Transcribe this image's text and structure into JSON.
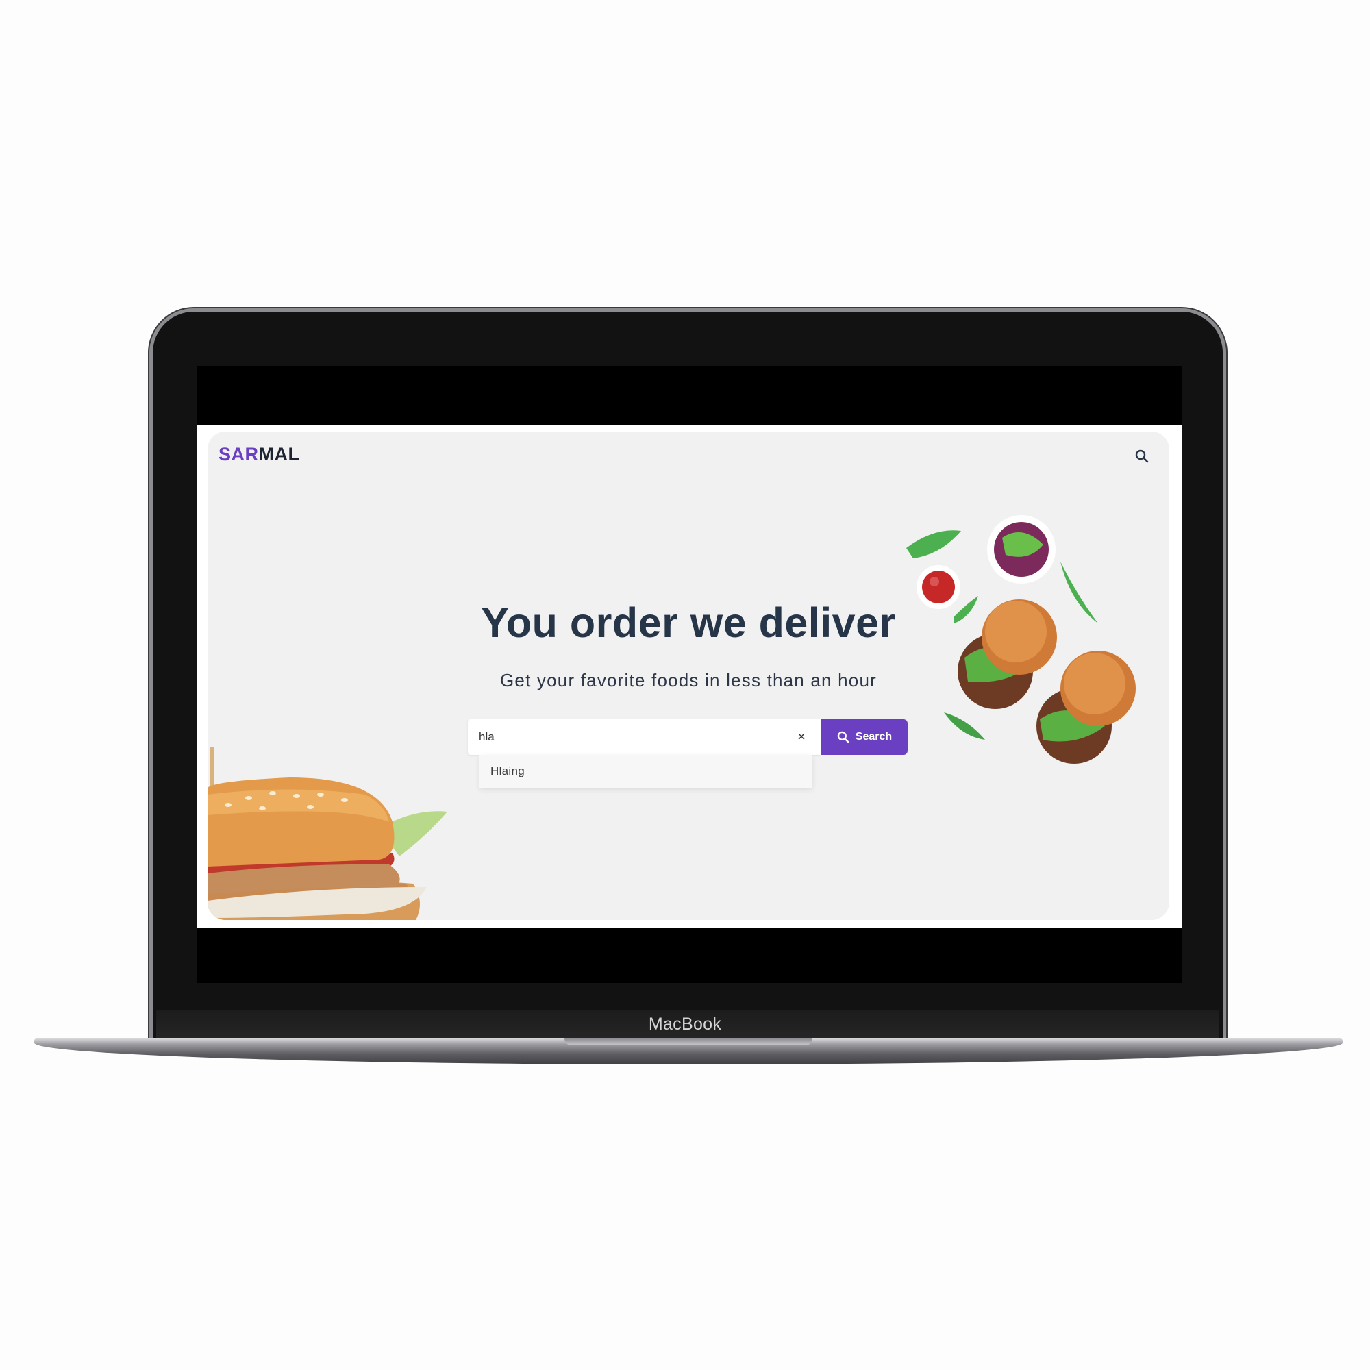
{
  "device": {
    "label": "MacBook"
  },
  "site": {
    "logo": {
      "part1": "SAR",
      "part2": "MAL"
    },
    "header": {
      "search_icon": "search-icon"
    },
    "hero": {
      "headline": "You order we deliver",
      "subheadline": "Get your favorite foods in less than an hour"
    },
    "search": {
      "value": "hla",
      "clear_icon": "close-icon",
      "button_label": "Search",
      "button_icon": "search-icon",
      "suggestions": [
        "Hlaing"
      ]
    }
  },
  "colors": {
    "accent": "#6a3fc1",
    "heading": "#273549",
    "hero_background": "#f1f1f1"
  }
}
